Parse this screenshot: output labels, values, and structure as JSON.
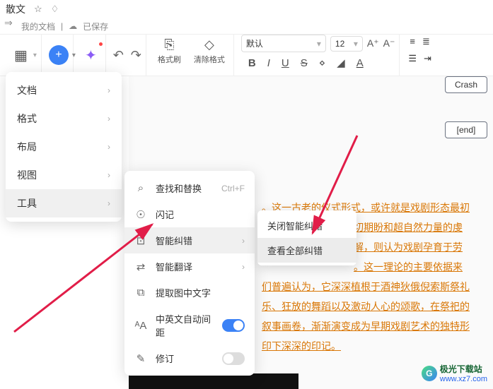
{
  "header": {
    "title": "散文"
  },
  "subheader": {
    "docs": "我的文档",
    "saved": "已保存"
  },
  "toolbar": {
    "format_brush": "格式刷",
    "clear_format": "清除格式",
    "font_name": "默认",
    "font_size": "12"
  },
  "menu1": {
    "items": [
      {
        "label": "文档"
      },
      {
        "label": "格式"
      },
      {
        "label": "布局"
      },
      {
        "label": "视图"
      },
      {
        "label": "工具"
      }
    ]
  },
  "menu2": {
    "find_replace": "查找和替换",
    "find_shortcut": "Ctrl+F",
    "flashnote": "闪记",
    "smart_correct": "智能纠错",
    "smart_translate": "智能翻译",
    "extract_text": "提取图中文字",
    "auto_spacing": "中英文自动间距",
    "revision": "修订"
  },
  "menu3": {
    "close_correct": "关闭智能纠错",
    "view_all": "查看全部纠错"
  },
  "flowchart": {
    "node1": "Crash",
    "node2": "[end]"
  },
  "body_text": {
    "line1a": "。这一古老的仪式形式，或许就是戏剧形态最初",
    "line1b": "切期盼和超自然力量的虔",
    "line2": "解，则认为戏剧孕育于劳",
    "line3": "。这一理论的主要依据来",
    "line4": "们普遍认为，它深深植根于酒神狄俄倪索斯祭礼",
    "line5": "乐、狂放的舞蹈以及激动人心的颂歌，在祭祀的",
    "line6": "叙事画卷，渐渐演变成为早期戏剧艺术的独特形",
    "line7": "印下深深的印记。"
  },
  "watermark": {
    "name": "极光下载站",
    "url": "www.xz7.com"
  }
}
